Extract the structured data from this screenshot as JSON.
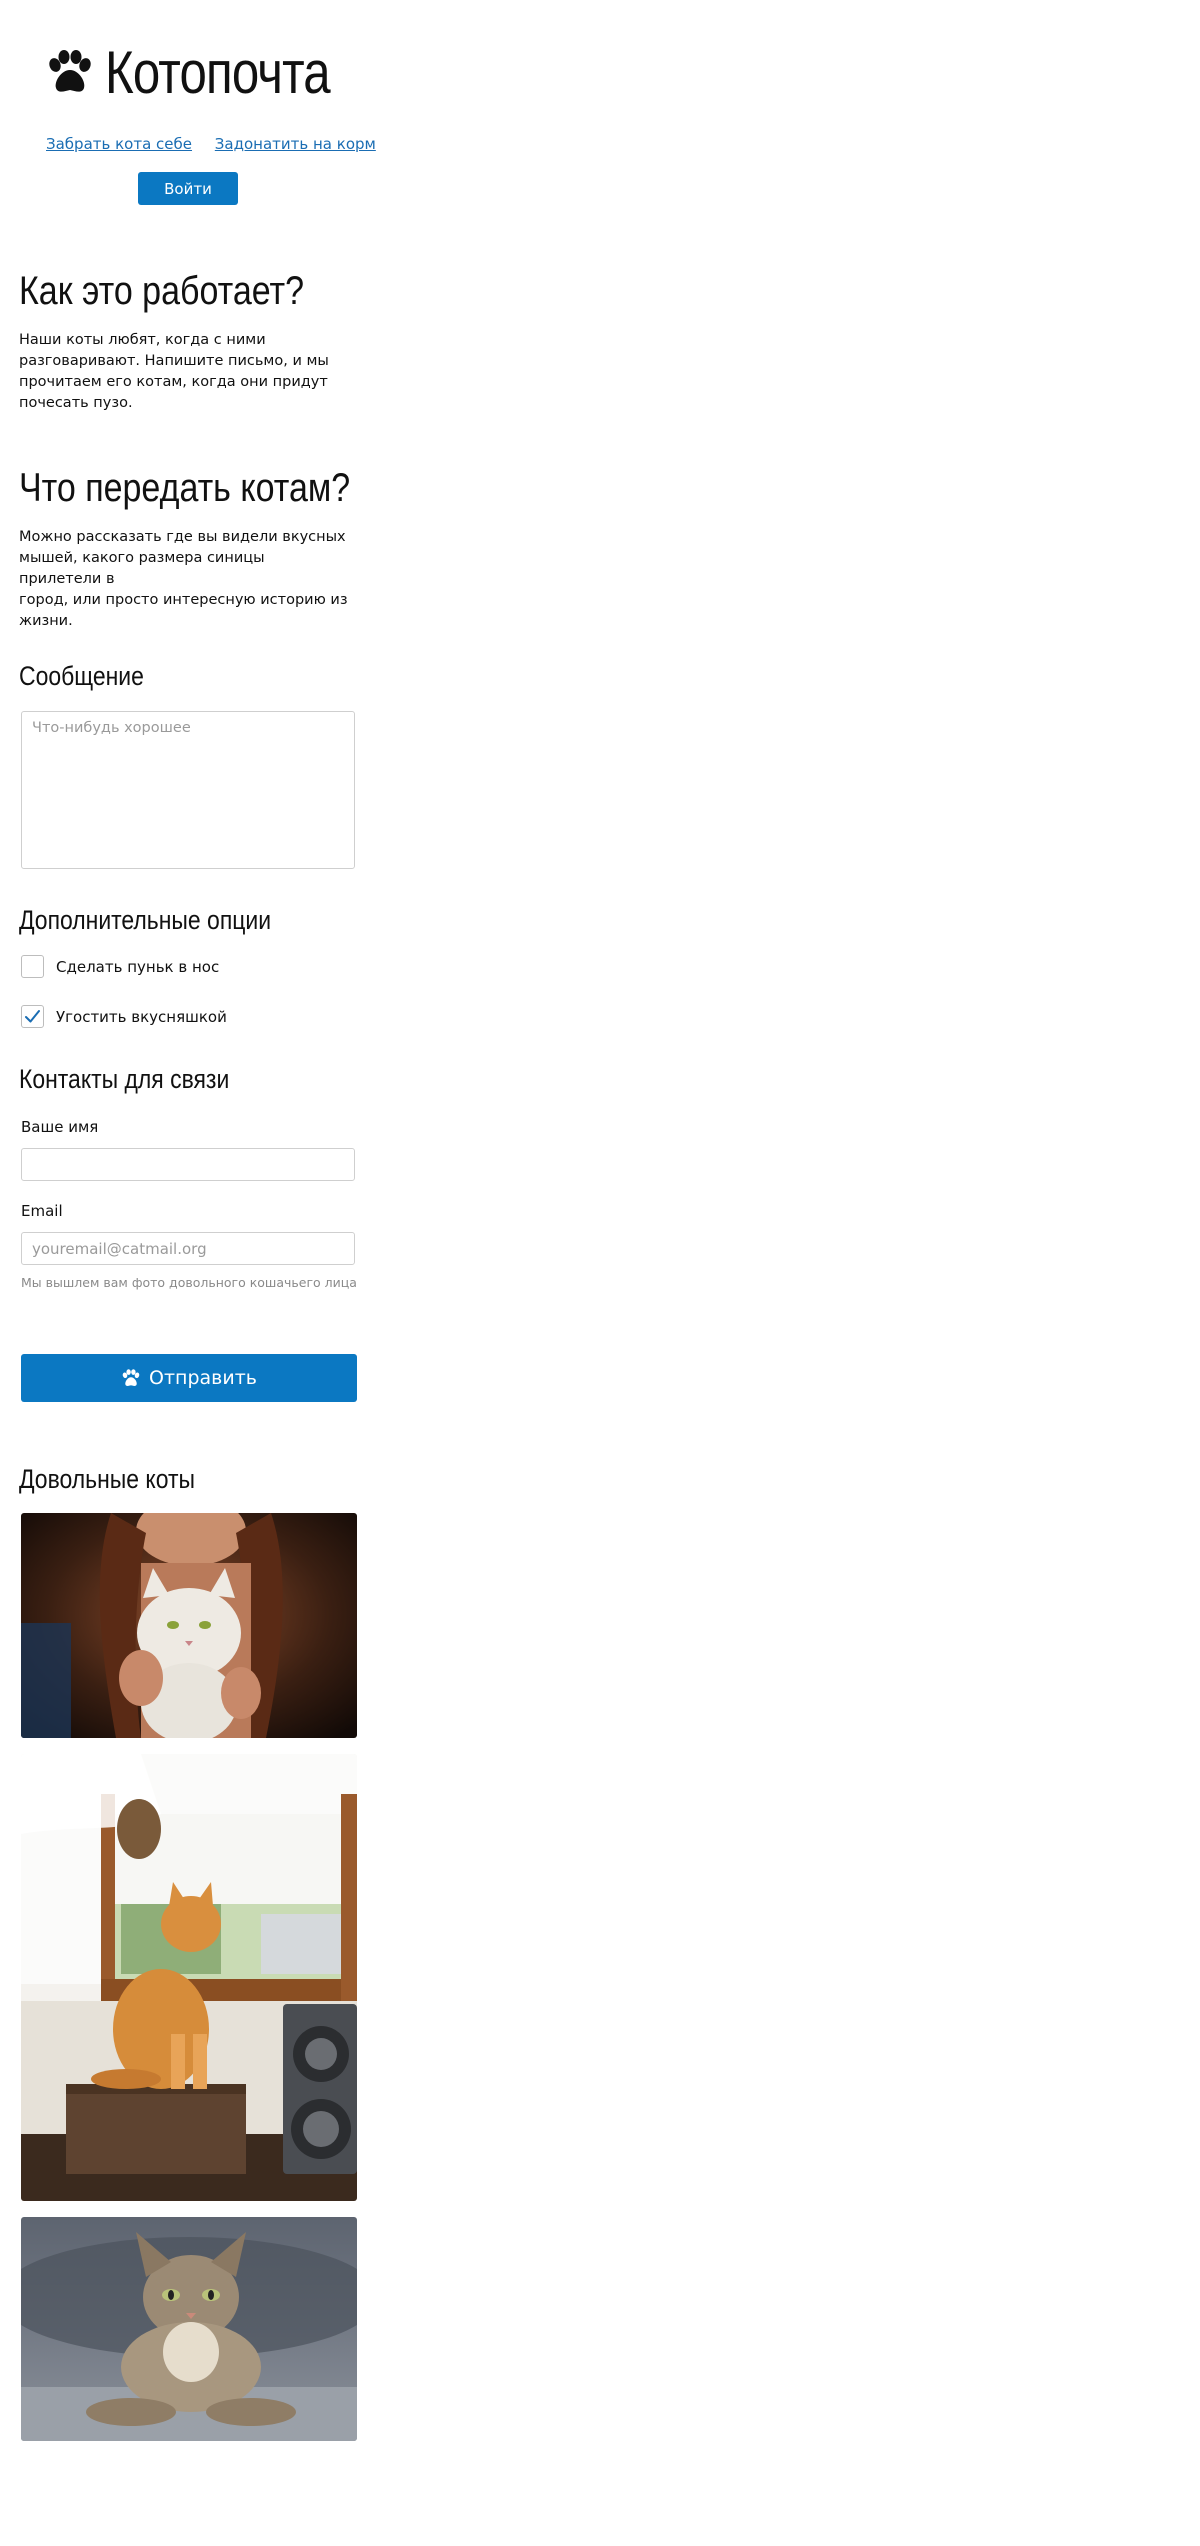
{
  "header": {
    "brand": "Котопочта",
    "brand_icon": "paw-icon",
    "links": [
      "Забрать кота себе",
      "Задонатить на корм"
    ],
    "login_label": "Войти"
  },
  "how": {
    "title": "Как это работает?",
    "lines": [
      "Наши коты любят, когда с ними",
      "разговаривают. Напишите письмо, и мы",
      "прочитаем его котам, когда они придут",
      "почесать пузо."
    ]
  },
  "what": {
    "title": "Что передать котам?",
    "lines": [
      "Можно рассказать где вы видели вкусных",
      "мышей, какого размера синицы прилетели в",
      "город, или просто интересную историю из",
      "жизни."
    ]
  },
  "form": {
    "message_title": "Сообщение",
    "message_placeholder": "Что-нибудь хорошее",
    "options_title": "Дополнительные опции",
    "options": [
      {
        "label": "Сделать пуньк в нос",
        "checked": false
      },
      {
        "label": "Угостить вкусняшкой",
        "checked": true
      }
    ],
    "contacts_title": "Контакты для связи",
    "name_label": "Ваше имя",
    "name_value": "",
    "email_label": "Email",
    "email_placeholder": "youremail@catmail.org",
    "email_hint": "Мы вышлем вам фото довольного кошачьего лица",
    "submit_label": "Отправить",
    "submit_icon": "paw-icon"
  },
  "gallery": {
    "title": "Довольные коты",
    "photos": [
      "girl-holding-white-cat-photo",
      "ginger-cat-by-window-photo",
      "tabby-cat-on-sofa-photo"
    ]
  },
  "colors": {
    "accent": "#0b78c2",
    "link": "#1a6db3",
    "border": "#cfcfcf",
    "hint": "#8a8a8a"
  }
}
